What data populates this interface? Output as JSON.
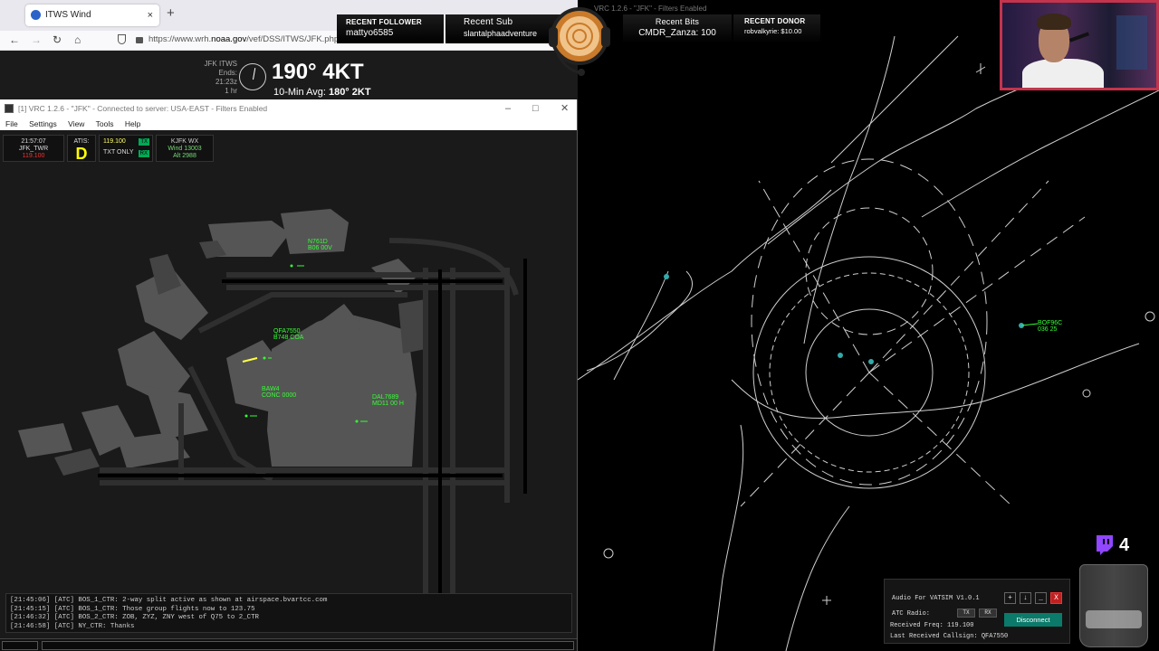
{
  "browser": {
    "tab_title": "ITWS Wind",
    "tab_close": "×",
    "new_tab": "+",
    "url_prefix": "https://www.wrh.",
    "url_host": "noaa.gov",
    "url_path": "/vef/DSS/ITWS/JFK.php"
  },
  "itws": {
    "site_line1": "JFK ITWS",
    "site_line2": "Ends: 21:23z",
    "site_line3": "1 hr",
    "wind": "190° 4KT",
    "avg_label": "10-Min Avg:",
    "avg_value": "180° 2KT"
  },
  "vrc": {
    "title": "[1] VRC 1.2.6 - \"JFK\" - Connected to server: USA-EAST - Filters Enabled",
    "menu": [
      "File",
      "Settings",
      "View",
      "Tools",
      "Help"
    ],
    "clock": {
      "time": "21:57:07",
      "position": "JFK_TWR",
      "freq": "119.100"
    },
    "atis": {
      "label": "ATIS:",
      "letter": "D"
    },
    "radio": {
      "freq": "119.100",
      "mode": "TXT ONLY",
      "tx": "TX",
      "rx": "RX"
    },
    "wx": {
      "station": "KJFK WX",
      "wind": "Wind 13003",
      "alt": "Alt 2988"
    },
    "log": [
      "[21:45:06] [ATC] BOS_1_CTR: 2-way split active as shown at airspace.bvartcc.com",
      "[21:45:15] [ATC] BOS_1_CTR: Those group flights now to 123.75",
      "[21:46:32] [ATC] BOS_2_CTR: ZOB, ZYZ, ZNY west of Q75 to 2_CTR",
      "[21:46:58] [ATC] NY_CTR: Thanks"
    ],
    "tags": [
      {
        "l1": "N761D",
        "l2": "B06  00V"
      },
      {
        "l1": "QFA7550",
        "l2": "B748 COA"
      },
      {
        "l1": "BAW4",
        "l2": "CONC 0000"
      },
      {
        "l1": "DAL7689",
        "l2": "MD11 00 H"
      }
    ]
  },
  "radar": {
    "title": "VRC 1.2.6 - \"JFK\" - Filters Enabled",
    "tag": {
      "l1": "BOF96C",
      "l2": "036 25"
    }
  },
  "overlay": {
    "follower_label": "RECENT FOLLOWER",
    "follower_value": "mattyo6585",
    "sub_label": "Recent Sub",
    "sub_value": "slantalphaadventure",
    "bits_label": "Recent Bits",
    "bits_value": "CMDR_Zanza: 100",
    "donor_label": "RECENT DONOR",
    "donor_value": "robvalkyrie: $10.00",
    "viewer_count": "4"
  },
  "afv": {
    "title": "Audio For VATSIM V1.0.1",
    "btn_add": "+",
    "btn_down": "↓",
    "btn_min": "_",
    "btn_close": "X",
    "radio_label": "ATC Radio:",
    "tx": "TX",
    "rx": "RX",
    "received_freq": "Received Freq: 119.100",
    "callsign": "Last Received Callsign: QFA7550",
    "disconnect": "Disconnect"
  },
  "colors": {
    "tag_green": "#33ff33",
    "atis_yellow": "#ffff00",
    "webcam_border": "#c4344c",
    "disconnect_teal": "#0b7a6a"
  }
}
